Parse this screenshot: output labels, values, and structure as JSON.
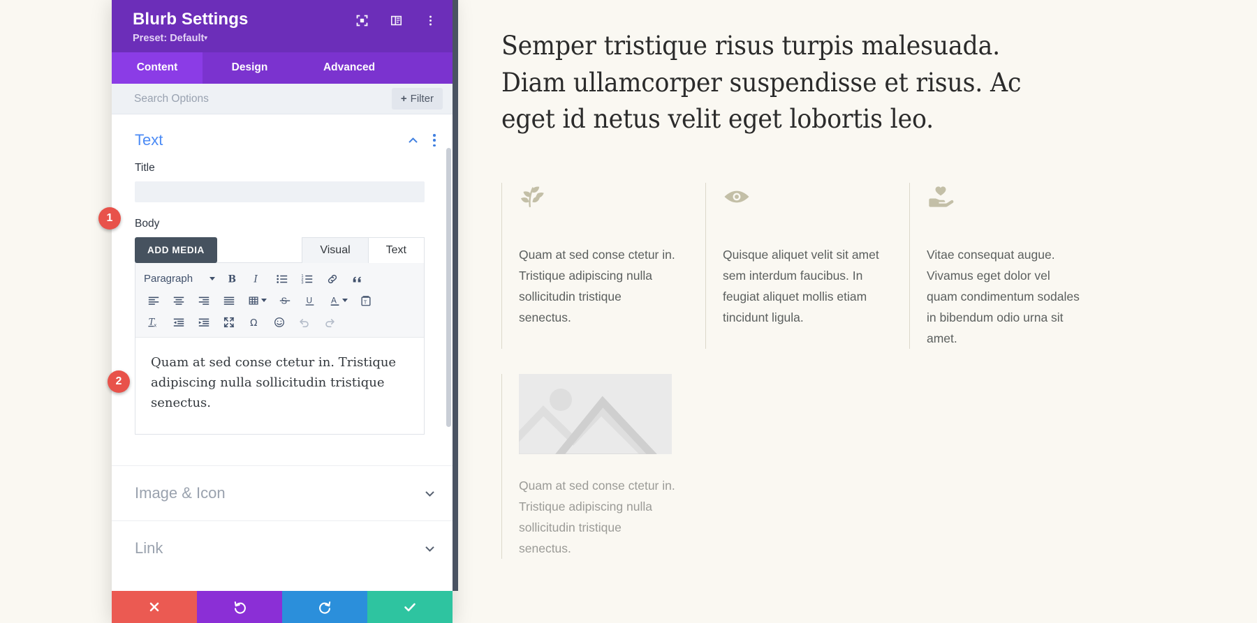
{
  "modal": {
    "title": "Blurb Settings",
    "preset_label": "Preset: Default",
    "preset_caret": "▾",
    "header_icons": [
      {
        "name": "focus-target-icon",
        "label": "Focus"
      },
      {
        "name": "layout-panel-icon",
        "label": "Layout"
      },
      {
        "name": "more-vertical-icon",
        "label": "More options"
      }
    ],
    "tabs": [
      {
        "label": "Content",
        "active": true
      },
      {
        "label": "Design",
        "active": false
      },
      {
        "label": "Advanced",
        "active": false
      }
    ],
    "search": {
      "placeholder": "Search Options",
      "value": "",
      "filter_label": "Filter",
      "filter_plus": "+"
    },
    "sections": [
      {
        "title": "Text",
        "state": "expanded"
      },
      {
        "title": "Image & Icon",
        "state": "collapsed"
      },
      {
        "title": "Link",
        "state": "collapsed"
      }
    ],
    "fields": {
      "title_label": "Title",
      "title_value": "",
      "body_label": "Body",
      "add_media_label": "ADD MEDIA",
      "editor_tabs": [
        {
          "label": "Visual",
          "active": true
        },
        {
          "label": "Text",
          "active": false
        }
      ],
      "format_select": "Paragraph",
      "body_value": "Quam at sed conse ctetur in. Tristique adipiscing nulla sollicitudin tristique senectus."
    },
    "toolbar_icons": [
      "bold-icon",
      "italic-icon",
      "bulleted-list-icon",
      "numbered-list-icon",
      "link-icon",
      "blockquote-icon",
      "align-left-icon",
      "align-center-icon",
      "align-right-icon",
      "align-justify-icon",
      "table-icon",
      "strikethrough-icon",
      "underline-icon",
      "text-color-icon",
      "paste-as-text-icon",
      "clear-formatting-icon",
      "outdent-icon",
      "indent-icon",
      "fullscreen-icon",
      "special-character-icon",
      "emoji-icon",
      "undo-icon",
      "redo-icon"
    ],
    "footer_buttons": [
      {
        "name": "cancel-button",
        "icon": "close-icon",
        "color": "#eb5a52"
      },
      {
        "name": "undo-button",
        "icon": "undo-icon",
        "color": "#8b2fd6"
      },
      {
        "name": "redo-button",
        "icon": "redo-icon",
        "color": "#2b8fdb"
      },
      {
        "name": "save-button",
        "icon": "check-icon",
        "color": "#2ec4a0"
      }
    ]
  },
  "callouts": [
    {
      "number": "1"
    },
    {
      "number": "2"
    }
  ],
  "preview": {
    "heading": "Semper tristique risus turpis malesuada. Diam ullamcorper suspendisse et risus. Ac eget id netus velit eget lobortis leo.",
    "blurbs": [
      {
        "icon": "leaf-branch-icon",
        "text": "Quam at sed conse ctetur in. Tristique adipiscing nulla sollicitudin tristique senectus."
      },
      {
        "icon": "eye-icon",
        "text": "Quisque aliquet velit sit amet sem interdum faucibus. In feugiat aliquet mollis etiam tincidunt ligula."
      },
      {
        "icon": "heart-in-hand-icon",
        "text": "Vitae consequat augue. Vivamus eget dolor vel quam condimentum sodales in bibendum odio urna sit amet."
      }
    ],
    "image_blurb": {
      "icon": "image-placeholder-icon",
      "text": "Quam at sed conse ctetur in. Tristique adipiscing nulla sollicitudin tristique senectus."
    }
  },
  "colors": {
    "modal_header": "#6c2eb9",
    "tab_active": "#8b3ce6",
    "tab_bar": "#7b33cf",
    "section_accent": "#4c8bf5",
    "callout": "#e8524a",
    "page_bg": "#faf8f2",
    "blurb_icon": "#c3bfa7"
  }
}
